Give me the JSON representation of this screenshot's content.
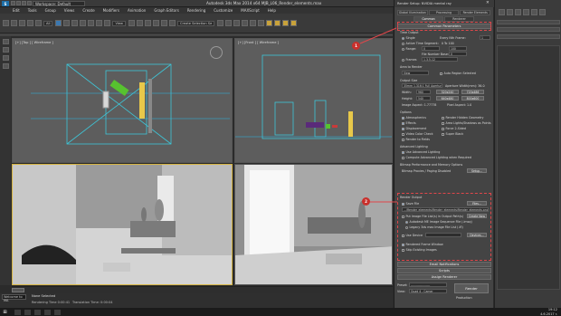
{
  "titlebar": {
    "app_logo": "S",
    "workspace": "Workspace: Default",
    "title": "Autodesk 3ds Max 2014 x64      MJB_L06_Render_elements.max"
  },
  "menubar": {
    "items": [
      "Edit",
      "Tools",
      "Group",
      "Views",
      "Create",
      "Modifiers",
      "Animation",
      "Graph Editors",
      "Rendering",
      "Customize",
      "MAXScript",
      "Help"
    ]
  },
  "toolbar": {
    "selection_filter": "All",
    "view_dropdown": "View",
    "named_set": "Create Selection Se"
  },
  "viewports": {
    "top_label": "[+] [Top ] [ Wireframe ]",
    "front_label": "[+] [Front ] [ Wireframe ]",
    "persp_label": "[+] [Perspective ] [ Realistic ]",
    "camera_label": "[+] [Camera001 ] [ Realistic ]"
  },
  "status": {
    "maxscript": "Welcome to MA",
    "selection": "None Selected",
    "render_time": "Rendering Time 0:00:41",
    "translation_time": "Translation Time: 0:00:04"
  },
  "taskbar": {
    "start": "⊞",
    "time": "19:12",
    "date": "4.6.2017 r."
  },
  "dialog": {
    "title": "Render Setup: NVIDIA mental ray",
    "tabs_row1": [
      "Global Illumination",
      "Processing",
      "Render Elements"
    ],
    "tabs_row2": [
      "Common",
      "Renderer"
    ],
    "common_params": "Common Parameters",
    "time_output": "Time Output",
    "single": "Single",
    "every_nth": "Every Nth Frame:",
    "every_nth_val": "1",
    "active_segment": "Active Time Segment:",
    "active_segment_val": "0 To 100",
    "range": "Range:",
    "range_from": "0",
    "range_to": "100",
    "file_number_base": "File Number Base:",
    "file_number_base_val": "0",
    "frames": "Frames",
    "frames_val": "1,3,5-12",
    "area_to_render": "Area to Render",
    "area_val": "View",
    "auto_region": "Auto Region Selected",
    "output_size": "Output Size",
    "output_preset": "35mm 1.316:1 Full Aperture (cine)",
    "aperture_width": "Aperture Width(mm): 36.0",
    "width_label": "Width:",
    "width_val": "960",
    "height_label": "Height:",
    "height_val": "540",
    "res_a": "320x240",
    "res_b": "720x486",
    "res_c": "640x480",
    "res_d": "800x600",
    "image_aspect": "Image Aspect: 1.77778",
    "pixel_aspect": "Pixel Aspect: 1.0",
    "options": "Options",
    "opt_atmospherics": "Atmospherics",
    "opt_render_hidden": "Render Hidden Geometry",
    "opt_effects": "Effects",
    "opt_area_lights": "Area Lights/Shadows as Points",
    "opt_displacement": "Displacement",
    "opt_force_2sided": "Force 2-Sided",
    "opt_video_color": "Video Color Check",
    "opt_super_black": "Super Black",
    "opt_render_fields": "Render to Fields",
    "advanced_lighting": "Advanced Lighting",
    "use_advanced": "Use Advanced Lighting",
    "compute_advanced": "Compute Advanced Lighting when Required",
    "bitmap_perf": "Bitmap Performance and Memory Options",
    "bitmap_proxies": "Bitmap Proxies / Paging Disabled",
    "setup_btn": "Setup...",
    "render_output": "Render Output",
    "save_file": "Save File",
    "files_btn": "Files...",
    "output_path": "...\\Render_elements\\Render_elements\\Render_elements.png",
    "put_image": "Put Image File List(s) in Output Path(s)",
    "create_now": "Create Now",
    "autodesk_seq": "Autodesk ME Image Sequence File (.imsq)",
    "legacy_seq": "Legacy 3ds max Image File List (.ifl)",
    "use_device": "Use Device",
    "devices_btn": "Devices...",
    "rendered_frame_window": "Rendered Frame Window",
    "skip_existing": "Skip Existing Images",
    "email_notifications": "Email Notifications",
    "scripts": "Scripts",
    "assign_renderer": "Assign Renderer",
    "preset_label": "Preset:",
    "preset_val": "-------------------",
    "view_label": "View:",
    "view_val": "Quad 4 - Camer",
    "render_btn": "Render",
    "production": "Production"
  },
  "callouts": [
    "1",
    "2"
  ],
  "colors": {
    "callout": "#e0464a",
    "viewport_active": "#d6b442",
    "accent": "#3b78b0"
  }
}
